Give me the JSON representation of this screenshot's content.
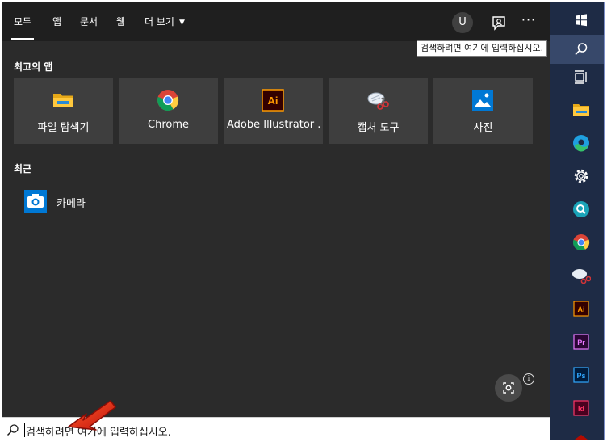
{
  "tabs": [
    "모두",
    "앱",
    "문서",
    "웹",
    "더 보기"
  ],
  "header": {
    "avatar_initial": "U",
    "more_label": "···"
  },
  "tooltip": "검색하려면 여기에 입력하십시오.",
  "top_apps": {
    "title": "최고의 앱",
    "items": [
      {
        "label": "파일 탐색기",
        "icon": "file-explorer-icon"
      },
      {
        "label": "Chrome",
        "icon": "chrome-icon"
      },
      {
        "label": "Adobe Illustrator ...",
        "icon": "illustrator-icon"
      },
      {
        "label": "캡처 도구",
        "icon": "snipping-tool-icon"
      },
      {
        "label": "사진",
        "icon": "photos-icon"
      }
    ]
  },
  "recent": {
    "title": "최근",
    "items": [
      {
        "label": "카메라",
        "icon": "camera-icon"
      }
    ]
  },
  "info_label": "i",
  "search": {
    "placeholder": "검색하려면 여기에 입력하십시오."
  },
  "taskbar": {
    "items": [
      "windows-start-icon",
      "search-icon",
      "task-view-icon",
      "file-explorer-icon",
      "edge-icon",
      "settings-icon",
      "search-app-icon",
      "chrome-icon",
      "snipping-tool-icon",
      "illustrator-icon",
      "premiere-icon",
      "photoshop-icon",
      "indesign-icon",
      "acrobat-icon"
    ],
    "labels": {
      "illustrator": "Ai",
      "premiere": "Pr",
      "photoshop": "Ps",
      "indesign": "Id"
    }
  },
  "colors": {
    "panel_bg": "#2b2b2b",
    "tile_bg": "#3e3e3e",
    "taskbar_bg": "#1e2b45",
    "accent_blue": "#0078d4"
  }
}
